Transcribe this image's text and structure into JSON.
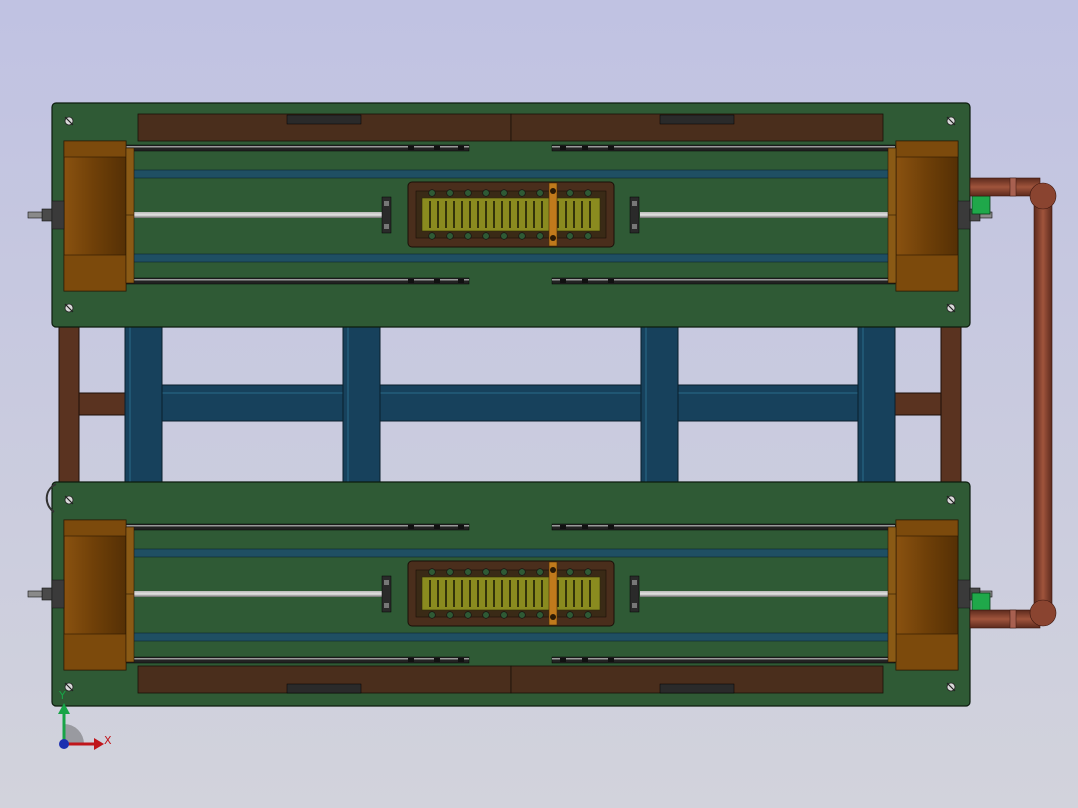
{
  "viewport": {
    "background_top": "#c0c2e2",
    "background_bottom": "#d2d3dc"
  },
  "model": {
    "plate_color": "#2f5a35",
    "motor_color": "#6e3f08",
    "rail_color": "#1f4f63",
    "frame_color": "#17415c",
    "pipe_color": "#7a3b2a",
    "pad_color": "#4a2e1c",
    "gear_color": "#8a8b1f",
    "sensor_color": "#1fa84a"
  },
  "triad": {
    "x_label": "X",
    "y_label": "Y",
    "x_color": "#c0161b",
    "y_color": "#18a447",
    "z_color": "#1b2fb0"
  }
}
